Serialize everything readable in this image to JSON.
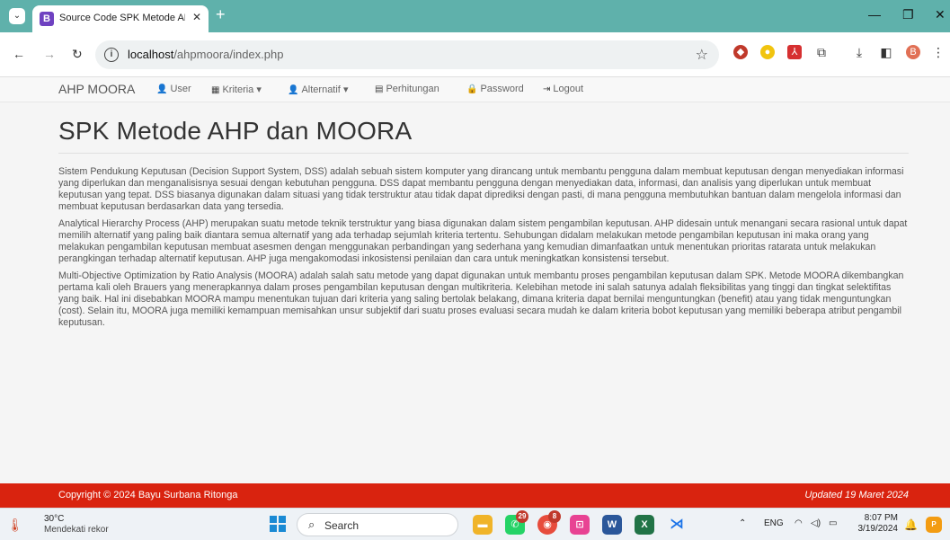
{
  "browser": {
    "tab_title": "Source Code SPK Metode AHP ",
    "tab_favicon_letter": "B",
    "new_tab": "+",
    "url_host": "localhost",
    "url_path": "/ahpmoora/index.php",
    "profile_letter": "B"
  },
  "navbar": {
    "brand": "AHP MOORA",
    "items": [
      {
        "label": "User",
        "icon": "user-icon"
      },
      {
        "label": "Kriteria",
        "icon": "grid-icon",
        "caret": true
      },
      {
        "label": "Alternatif",
        "icon": "user-icon",
        "caret": true
      },
      {
        "label": "Perhitungan",
        "icon": "calendar-icon"
      },
      {
        "label": "Password",
        "icon": "lock-icon"
      },
      {
        "label": "Logout",
        "icon": "logout-icon"
      }
    ]
  },
  "main": {
    "title": "SPK Metode AHP dan MOORA",
    "paragraphs": [
      "Sistem Pendukung Keputusan (Decision Support System, DSS) adalah sebuah sistem komputer yang dirancang untuk membantu pengguna dalam membuat keputusan dengan menyediakan informasi yang diperlukan dan menganalisisnya sesuai dengan kebutuhan pengguna. DSS dapat membantu pengguna dengan menyediakan data, informasi, dan analisis yang diperlukan untuk membuat keputusan yang tepat. DSS biasanya digunakan dalam situasi yang tidak terstruktur atau tidak dapat diprediksi dengan pasti, di mana pengguna membutuhkan bantuan dalam mengelola informasi dan membuat keputusan berdasarkan data yang tersedia.",
      "Analytical Hierarchy Process (AHP) merupakan suatu metode teknik terstruktur yang biasa digunakan dalam sistem pengambilan keputusan. AHP didesain untuk menangani secara rasional untuk dapat memilih alternatif yang paling baik diantara semua alternatif yang ada terhadap sejumlah kriteria tertentu. Sehubungan didalam melakukan metode pengambilan keputusan ini maka orang yang melakukan pengambilan keputusan membuat asesmen dengan menggunakan perbandingan yang sederhana yang kemudian dimanfaatkan untuk menentukan prioritas ratarata untuk melakukan perangkingan terhadap alternatif keputusan. AHP juga mengakomodasi inkosistensi penilaian dan cara untuk meningkatkan konsistensi tersebut.",
      "Multi-Objective Optimization by Ratio Analysis (MOORA) adalah salah satu metode yang dapat digunakan untuk membantu proses pengambilan keputusan dalam SPK. Metode MOORA dikembangkan pertama kali oleh Brauers yang menerapkannya dalam proses pengambilan keputusan dengan multikriteria. Kelebihan metode ini salah satunya adalah fleksibilitas yang tinggi dan tingkat selektifitas yang baik. Hal ini disebabkan MOORA mampu menentukan tujuan dari kriteria yang saling bertolak belakang, dimana kriteria dapat bernilai menguntungkan (benefit) atau yang tidak menguntungkan (cost). Selain itu, MOORA juga memiliki kemampuan memisahkan unsur subjektif dari suatu proses evaluasi secara mudah ke dalam kriteria bobot keputusan yang memiliki beberapa atribut pengambil keputusan."
    ]
  },
  "footer": {
    "copyright": "Copyright © 2024 Bayu Surbana Ritonga",
    "updated": "Updated 19 Maret 2024",
    "color": "#d9230f"
  },
  "taskbar": {
    "temp": "30°C",
    "condition": "Mendekati rekor",
    "search_label": "Search",
    "whatsapp_badge": "29",
    "chrome_badge": "8",
    "language": "ENG",
    "time": "8:07 PM",
    "date": "3/19/2024"
  }
}
